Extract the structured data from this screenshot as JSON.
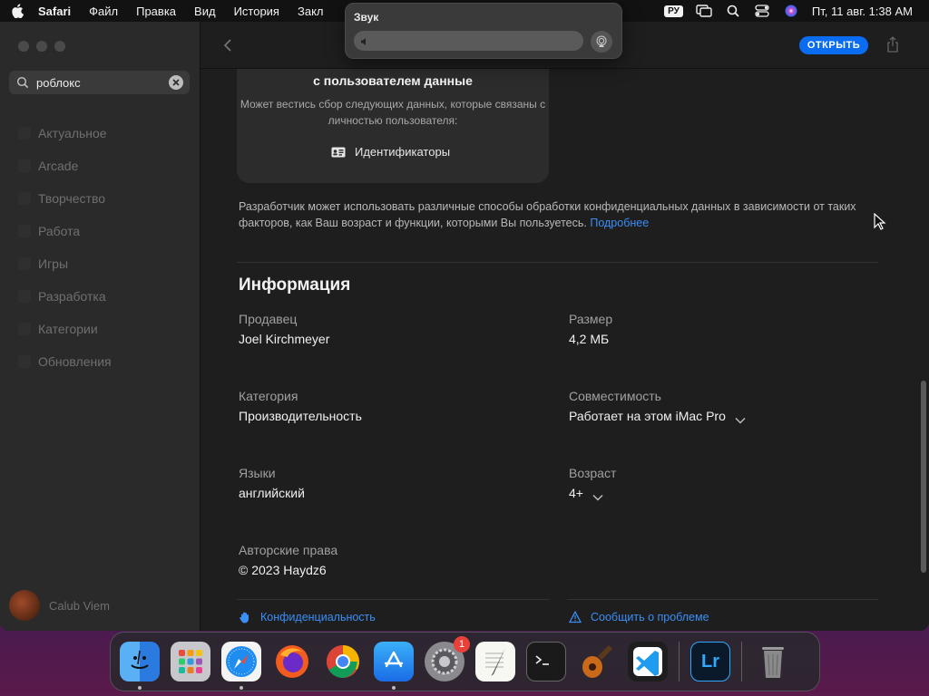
{
  "menubar": {
    "app": "Safari",
    "items": [
      "Файл",
      "Правка",
      "Вид",
      "История",
      "Закл"
    ],
    "keyboard_layout": "РУ",
    "clock": "Пт, 11 авг.  1:38 AM"
  },
  "sound_popover": {
    "title": "Звук",
    "volume": 0.0
  },
  "sidebar": {
    "search": {
      "value": "роблокс"
    },
    "items": [
      {
        "label": "Актуальное"
      },
      {
        "label": "Arcade"
      },
      {
        "label": "Творчество"
      },
      {
        "label": "Работа"
      },
      {
        "label": "Игры"
      },
      {
        "label": "Разработка"
      },
      {
        "label": "Категории"
      },
      {
        "label": "Обновления"
      }
    ],
    "user_name": "Calub Viem"
  },
  "toolbar": {
    "open_label": "ОТКРЫТЬ"
  },
  "privacy_card": {
    "title": "с пользователем данные",
    "description": "Может вестись сбор следующих данных, которые связаны с личностью пользователя:",
    "identifiers_label": "Идентификаторы"
  },
  "dev_note": {
    "text": "Разработчик может использовать различные способы обработки конфиденциальных данных в зависимости от таких факторов, как Ваш возраст и функции, которыми Вы пользуетесь.",
    "link": "Подробнее"
  },
  "info": {
    "title": "Информация",
    "seller": {
      "label": "Продавец",
      "value": "Joel Kirchmeyer"
    },
    "size": {
      "label": "Размер",
      "value": "4,2 МБ"
    },
    "category": {
      "label": "Категория",
      "value": "Производительность"
    },
    "compatibility": {
      "label": "Совместимость",
      "value": "Работает на этом iMac Pro"
    },
    "languages": {
      "label": "Языки",
      "value": "английский"
    },
    "age": {
      "label": "Возраст",
      "value": "4+"
    },
    "copyright": {
      "label": "Авторские права",
      "value": "© 2023 Haydz6"
    }
  },
  "footer": {
    "privacy_link": "Конфиденциальность",
    "report_link": "Сообщить о проблеме"
  },
  "dock": {
    "system_preferences_badge": "1",
    "apps": [
      "finder",
      "launchpad",
      "safari",
      "firefox",
      "chrome",
      "app-store",
      "system-preferences",
      "textedit",
      "terminal",
      "garageband",
      "vscode",
      "lightroom",
      "trash"
    ]
  },
  "colors": {
    "accent": "#0a6cf0",
    "link": "#3a8ef6"
  }
}
